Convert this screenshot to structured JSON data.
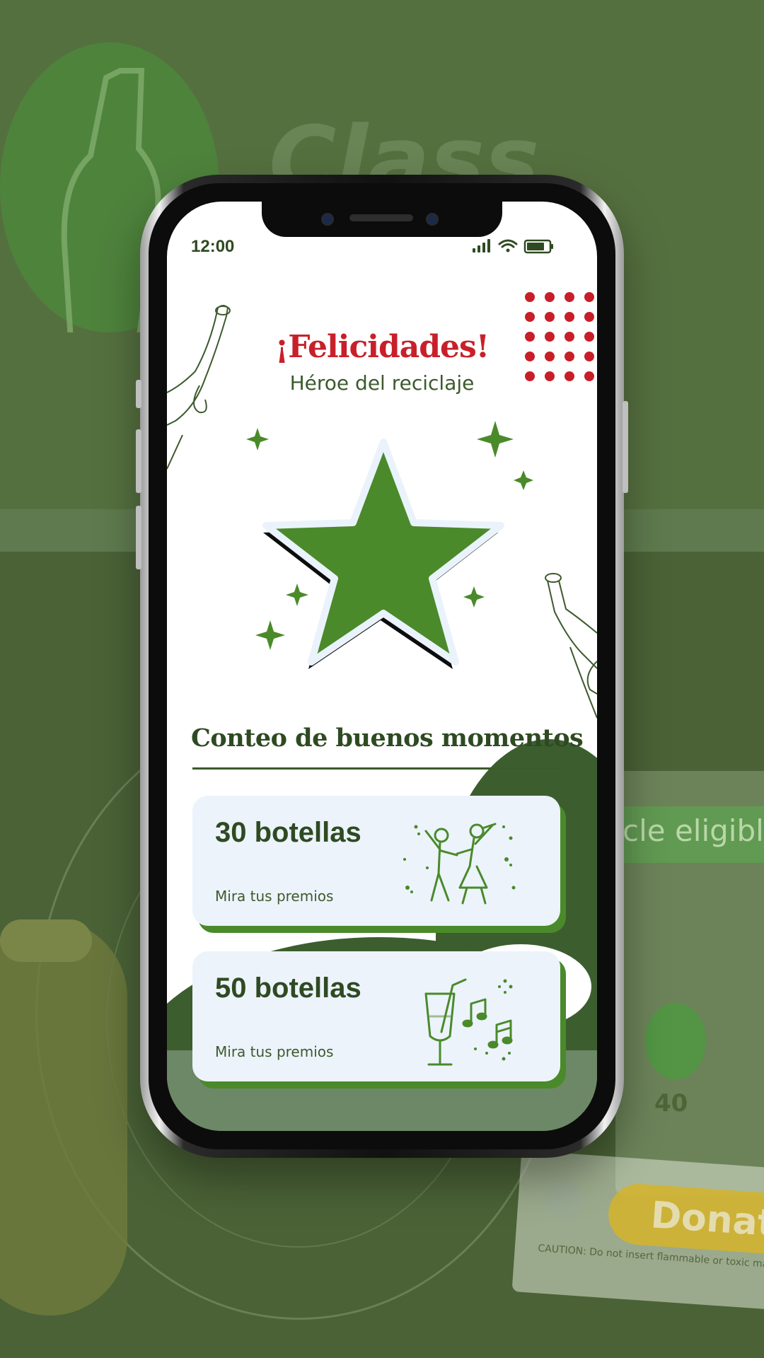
{
  "background": {
    "sign_text": "Class",
    "eligible_text": "cle eligible g",
    "counter": "40",
    "donate_label": "Donate",
    "caution_text": "CAUTION: Do not insert flammable or toxic materials"
  },
  "status_bar": {
    "time": "12:00",
    "signal_icon": "signal-icon",
    "wifi_icon": "wifi-icon",
    "battery_icon": "battery-icon"
  },
  "header": {
    "title": "¡Felicidades!",
    "subtitle": "Héroe del reciclaje"
  },
  "badge": {
    "icon": "star-icon",
    "color": "#4a8a2a"
  },
  "section": {
    "title": "Conteo de buenos momentos"
  },
  "rewards": [
    {
      "count": "30 botellas",
      "link": "Mira tus premios",
      "icon": "dancing-couple-icon"
    },
    {
      "count": "50 botellas",
      "link": "Mira tus premios",
      "icon": "drink-music-icon"
    }
  ],
  "colors": {
    "primary_green": "#4a8a2a",
    "dark_green": "#2f4a22",
    "accent_red": "#c8202a",
    "card_bg": "#ecf3fb"
  }
}
